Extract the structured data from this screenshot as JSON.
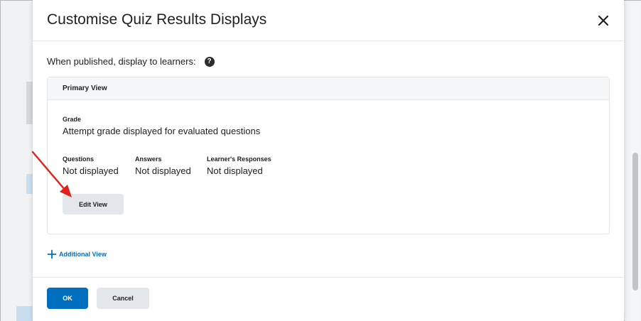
{
  "dialog": {
    "title": "Customise Quiz Results Displays",
    "close_icon": "close-icon"
  },
  "intro": {
    "text": "When published, display to learners:",
    "help_icon": "question-circle-icon",
    "help_glyph": "?"
  },
  "primary_view": {
    "header": "Primary View",
    "grade_label": "Grade",
    "grade_value": "Attempt grade displayed for evaluated questions",
    "questions_label": "Questions",
    "questions_value": "Not displayed",
    "answers_label": "Answers",
    "answers_value": "Not displayed",
    "responses_label": "Learner's Responses",
    "responses_value": "Not displayed",
    "edit_button": "Edit View"
  },
  "additional_view": {
    "label": "Additional View",
    "icon": "plus-icon"
  },
  "footer": {
    "ok_label": "OK",
    "cancel_label": "Cancel"
  },
  "colors": {
    "primary": "#006fbf",
    "annotation_arrow": "#e0201b"
  }
}
